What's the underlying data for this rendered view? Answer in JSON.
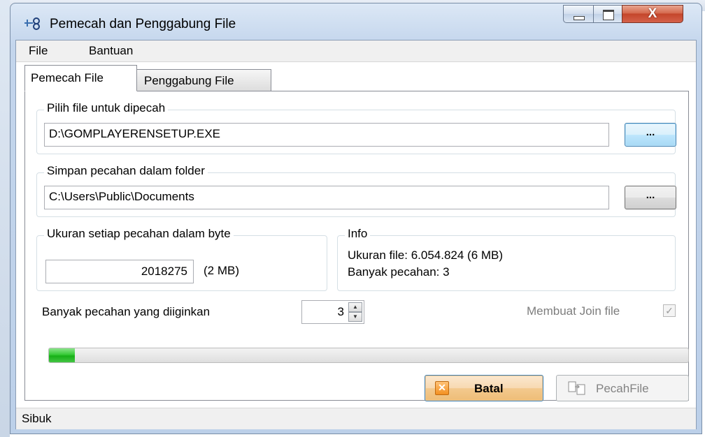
{
  "window": {
    "title": "Pemecah dan Penggabung File",
    "close_glyph": "X"
  },
  "menu": {
    "items": [
      "File",
      "Bantuan"
    ]
  },
  "tabs": [
    {
      "label": "Pemecah File",
      "active": true
    },
    {
      "label": "Penggabung File",
      "active": false
    }
  ],
  "source": {
    "group_label": "Pilih file untuk dipecah",
    "path": "D:\\GOMPLAYERENSETUP.EXE",
    "browse_label": "..."
  },
  "destination": {
    "group_label": "Simpan pecahan dalam folder",
    "path": "C:\\Users\\Public\\Documents",
    "browse_label": "..."
  },
  "chunk_size": {
    "group_label": "Ukuran setiap pecahan dalam byte",
    "value": "2018275",
    "unit_text": "(2 MB)"
  },
  "info": {
    "group_label": "Info",
    "file_size": "Ukuran file: 6.054.824 (6 MB)",
    "chunk_count": "Banyak pecahan: 3"
  },
  "chunks_wanted": {
    "label": "Banyak pecahan yang diiginkan",
    "value": "3"
  },
  "join_file": {
    "label": "Membuat Join file",
    "checked": true,
    "check_glyph": "✓"
  },
  "progress": {
    "fraction": 0.04
  },
  "buttons": {
    "cancel_label": "Batal",
    "cancel_icon_glyph": "✕",
    "split_label": "PecahFile"
  },
  "status": {
    "text": "Sibuk"
  },
  "colors": {
    "progress_fill": "#22b422",
    "close_button": "#c9492d"
  }
}
